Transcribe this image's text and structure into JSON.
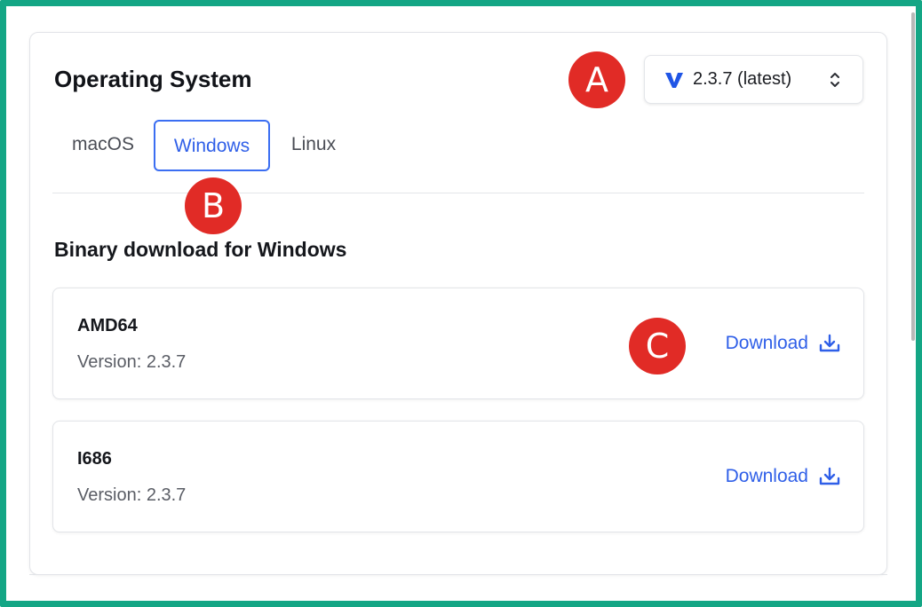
{
  "header": {
    "title": "Operating System",
    "version_select": {
      "icon": "v-logo-icon",
      "value": "2.3.7 (latest)"
    }
  },
  "tabs": [
    {
      "label": "macOS",
      "active": false
    },
    {
      "label": "Windows",
      "active": true
    },
    {
      "label": "Linux",
      "active": false
    }
  ],
  "section": {
    "title": "Binary download for Windows"
  },
  "downloads": [
    {
      "arch": "AMD64",
      "version": "Version: 2.3.7",
      "action": "Download"
    },
    {
      "arch": "I686",
      "version": "Version: 2.3.7",
      "action": "Download"
    }
  ],
  "markers": [
    "A",
    "B",
    "C"
  ],
  "colors": {
    "frame": "#14a685",
    "accent": "#2f5fe8",
    "marker": "#e12b26"
  }
}
